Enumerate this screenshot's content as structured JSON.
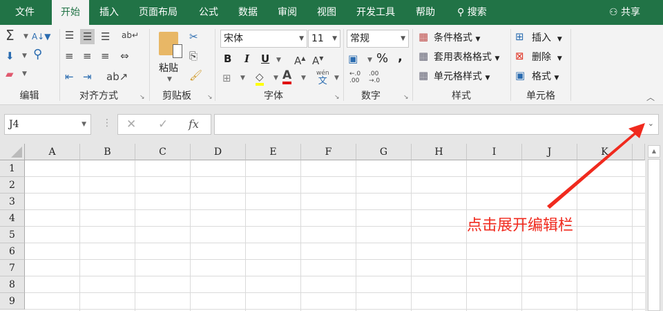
{
  "tabs": [
    "文件",
    "开始",
    "插入",
    "页面布局",
    "公式",
    "数据",
    "审阅",
    "视图",
    "开发工具",
    "帮助",
    "搜索"
  ],
  "share": "共享",
  "ribbon": {
    "groups": [
      "编辑",
      "对齐方式",
      "剪贴板",
      "字体",
      "数字",
      "样式",
      "单元格"
    ],
    "paste": "粘贴",
    "font_name": "宋体",
    "font_size": "11",
    "number_format": "常规",
    "bold": "B",
    "italic": "I",
    "underline": "U",
    "percent": "%",
    "comma": ",",
    "styles": [
      "条件格式",
      "套用表格格式",
      "单元格样式"
    ],
    "cells": [
      "插入",
      "删除",
      "格式"
    ],
    "phonetic_top": "wén",
    "phonetic_bottom": "文"
  },
  "formula_bar": {
    "name_box": "J4",
    "fx": "fx",
    "value": ""
  },
  "columns": [
    "A",
    "B",
    "C",
    "D",
    "E",
    "F",
    "G",
    "H",
    "I",
    "J",
    "K"
  ],
  "rows": [
    "1",
    "2",
    "3",
    "4",
    "5",
    "6",
    "7",
    "8",
    "9"
  ],
  "annotation": "点击展开编辑栏",
  "colors": {
    "accent": "#217346",
    "annotation": "#f02a1e"
  }
}
